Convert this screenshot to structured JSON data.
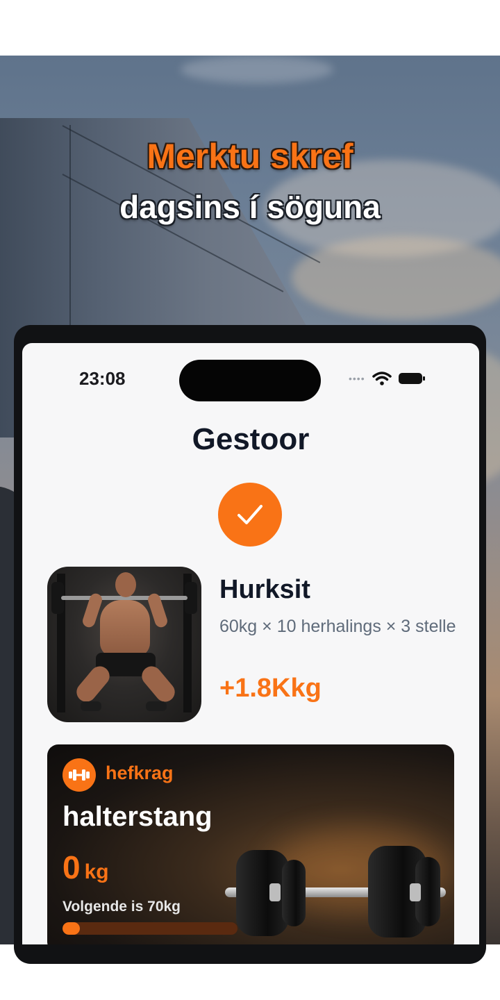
{
  "promo": {
    "headline_line1": "Merktu skref",
    "headline_line2": "dagsins í söguna"
  },
  "status_bar": {
    "time": "23:08"
  },
  "screen": {
    "title": "Gestoor"
  },
  "exercise": {
    "name": "Hurksit",
    "detail": "60kg × 10 herhalings × 3 stelle",
    "gain": "+1.8Kkg"
  },
  "strength_card": {
    "tag": "hefkrag",
    "title": "halterstang",
    "value": "0",
    "unit": "kg",
    "next_label": "Volgende is 70kg",
    "progress_fraction": 0.1
  },
  "colors": {
    "accent": "#f97316",
    "text_dark": "#111827",
    "text_muted": "#5f6b7a"
  },
  "icons": [
    "checkmark-icon",
    "wifi-icon",
    "battery-icon",
    "dumbbell-icon"
  ]
}
